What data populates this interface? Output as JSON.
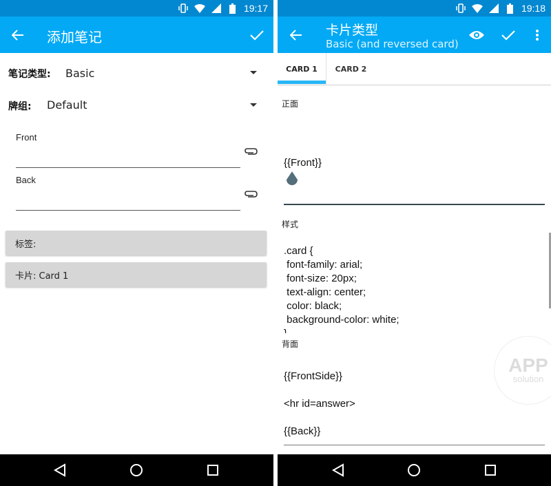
{
  "left_screen": {
    "status": {
      "time": "19:17"
    },
    "appbar": {
      "title": "添加笔记"
    },
    "note_type": {
      "label": "笔记类型:",
      "value": "Basic"
    },
    "deck": {
      "label": "牌组:",
      "value": "Default"
    },
    "fields": [
      {
        "label": "Front",
        "value": ""
      },
      {
        "label": "Back",
        "value": ""
      }
    ],
    "tags_button": "标签:",
    "cards_button": "卡片: Card 1"
  },
  "right_screen": {
    "status": {
      "time": "19:18"
    },
    "appbar": {
      "title": "卡片类型",
      "subtitle": "Basic (and reversed card)"
    },
    "tabs": [
      {
        "label": "CARD 1",
        "selected": true
      },
      {
        "label": "CARD 2",
        "selected": false
      }
    ],
    "front_template": {
      "label": "正面",
      "content": "{{Front}}"
    },
    "styling": {
      "label": "样式",
      "content": ".card {\n font-family: arial;\n font-size: 20px;\n text-align: center;\n color: black;\n background-color: white;\n}"
    },
    "back_template": {
      "label": "背面",
      "line1": "{{FrontSide}}",
      "line2": "<hr id=answer>",
      "line3": "{{Back}}"
    },
    "watermark": {
      "line1": "APP",
      "line2": "solution"
    }
  },
  "colors": {
    "status_bar": "#0288d1",
    "app_bar": "#03a9f4",
    "tab_indicator": "#29b6f6",
    "button_gray": "#d6d6d6"
  },
  "icons": {
    "status": [
      "vibrate-icon",
      "wifi-icon",
      "signal-icon",
      "battery-icon"
    ],
    "appbar_left": [
      "back-arrow-icon",
      "check-icon"
    ],
    "appbar_right": [
      "back-arrow-icon",
      "eye-icon",
      "check-icon",
      "more-vert-icon"
    ],
    "navbar": [
      "back-triangle-icon",
      "home-circle-icon",
      "recents-square-icon"
    ]
  }
}
